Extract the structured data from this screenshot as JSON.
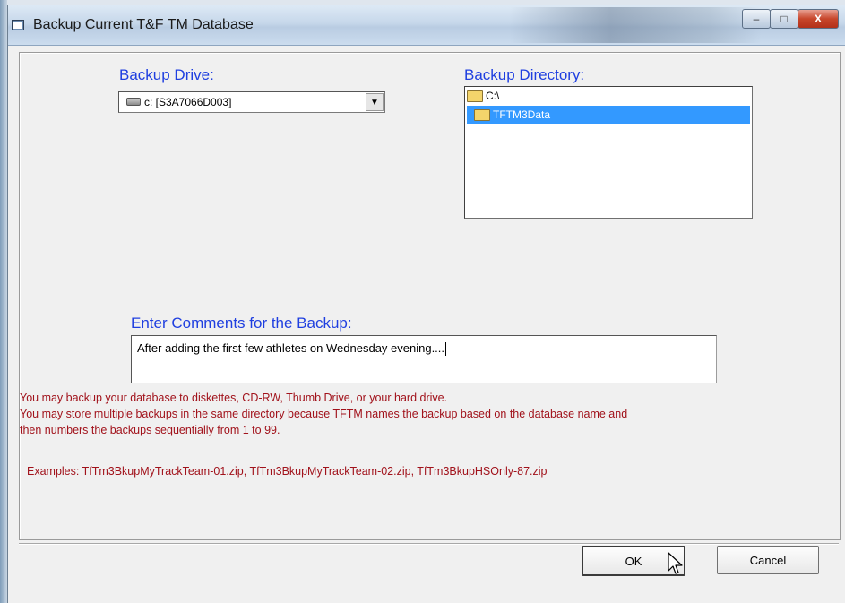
{
  "window": {
    "title": "Backup Current T&F TM Database",
    "controls": {
      "minimize": "–",
      "maximize": "□",
      "close": "X"
    }
  },
  "backup_drive": {
    "label": "Backup Drive:",
    "value": "c: [S3A7066D003]",
    "icon": "drive-icon"
  },
  "backup_directory": {
    "label": "Backup Directory:",
    "items": [
      {
        "label": "C:\\",
        "selected": false,
        "icon": "folder-icon"
      },
      {
        "label": "TFTM3Data",
        "selected": true,
        "icon": "folder-icon"
      }
    ]
  },
  "comments": {
    "label": "Enter Comments for the Backup:",
    "value": "After adding the first few athletes on Wednesday evening...."
  },
  "notes": {
    "line1": "You may backup your database to diskettes, CD-RW, Thumb Drive, or your hard drive.",
    "line2": "You may store multiple backups in the same directory because TFTM names the backup based on the database name and",
    "line3": "then numbers the backups sequentially from 1 to 99.",
    "examples": "Examples: TfTm3BkupMyTrackTeam-01.zip, TfTm3BkupMyTrackTeam-02.zip, TfTm3BkupHSOnly-87.zip"
  },
  "buttons": {
    "ok": "OK",
    "cancel": "Cancel"
  },
  "colors": {
    "label_blue": "#1f3fe0",
    "note_red": "#a1121b",
    "selection": "#3399ff"
  }
}
